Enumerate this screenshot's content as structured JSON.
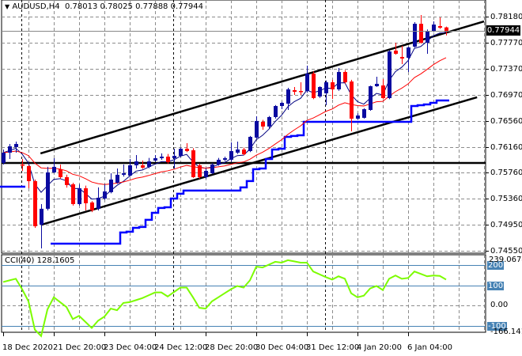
{
  "header": {
    "symbol": "AUDUSD,H4",
    "ohlc_text": "0.78013 0.78025 0.77888 0.77944"
  },
  "current_price": "0.77944",
  "cci_label": "CCI(40) 128.1605",
  "colors": {
    "bull": "#0a0aa0",
    "bear": "#ff0000",
    "ma_fast": "#000080",
    "ma_slow": "#ff0000",
    "step_line": "#0000ff",
    "cci": "#7cfc00",
    "level": "#4682b4",
    "grid": "#8c8c8c"
  },
  "chart_data": [
    {
      "type": "candlestick",
      "title": "AUDUSD,H4",
      "ylim": [
        0.7455,
        0.7818
      ],
      "price_ticks": [
        "0.78180",
        "0.77770",
        "0.77370",
        "0.76970",
        "0.76560",
        "0.76160",
        "0.75760",
        "0.75360",
        "0.74950",
        "0.74550"
      ],
      "time_labels": [
        {
          "text": "18 Dec 2020",
          "index": 0
        },
        {
          "text": "21 Dec 20:00",
          "index": 8
        },
        {
          "text": "23 Dec 04:00",
          "index": 16
        },
        {
          "text": "24 Dec 12:00",
          "index": 24
        },
        {
          "text": "28 Dec 20:00",
          "index": 32
        },
        {
          "text": "30 Dec 04:00",
          "index": 40
        },
        {
          "text": "31 Dec 12:00",
          "index": 48
        },
        {
          "text": "4 Jan 20:00",
          "index": 56
        },
        {
          "text": "6 Jan 04:00",
          "index": 64
        }
      ],
      "ohlc": [
        [
          0.75912,
          0.7612,
          0.75887,
          0.76071
        ],
        [
          0.76071,
          0.76206,
          0.75973,
          0.76169
        ],
        [
          0.76157,
          0.76243,
          0.76071,
          0.76206
        ],
        [
          0.75887,
          0.75973,
          0.75789,
          0.75875
        ],
        [
          0.75863,
          0.75875,
          0.75519,
          0.7563
        ],
        [
          0.7563,
          0.75654,
          0.74906,
          0.74931
        ],
        [
          0.74955,
          0.75274,
          0.74587,
          0.75201
        ],
        [
          0.75201,
          0.75851,
          0.75176,
          0.75765
        ],
        [
          0.75765,
          0.75985,
          0.75752,
          0.75851
        ],
        [
          0.75814,
          0.75887,
          0.75667,
          0.75691
        ],
        [
          0.75691,
          0.75728,
          0.7553,
          0.75569
        ],
        [
          0.75581,
          0.75605,
          0.7525,
          0.75274
        ],
        [
          0.75274,
          0.75581,
          0.7525,
          0.75519
        ],
        [
          0.75519,
          0.7556,
          0.75176,
          0.75287
        ],
        [
          0.75299,
          0.7532,
          0.7515,
          0.75176
        ],
        [
          0.75201,
          0.75532,
          0.75176,
          0.75372
        ],
        [
          0.7536,
          0.75581,
          0.7534,
          0.7547
        ],
        [
          0.75458,
          0.75752,
          0.7544,
          0.75654
        ],
        [
          0.75605,
          0.75826,
          0.7559,
          0.75728
        ],
        [
          0.75728,
          0.75887,
          0.757,
          0.75752
        ],
        [
          0.75716,
          0.75973,
          0.757,
          0.75875
        ],
        [
          0.75875,
          0.76034,
          0.75826,
          0.75936
        ],
        [
          0.75875,
          0.75949,
          0.7582,
          0.75838
        ],
        [
          0.75851,
          0.7599,
          0.7583,
          0.75936
        ],
        [
          0.75949,
          0.76034,
          0.7593,
          0.75985
        ],
        [
          0.75985,
          0.7606,
          0.7596,
          0.7601
        ],
        [
          0.7601,
          0.7605,
          0.759,
          0.75924
        ],
        [
          0.75985,
          0.76132,
          0.75826,
          0.76022
        ],
        [
          0.76022,
          0.7615,
          0.76,
          0.76132
        ],
        [
          0.76132,
          0.76218,
          0.7608,
          0.76096
        ],
        [
          0.76108,
          0.7614,
          0.7568,
          0.75691
        ],
        [
          0.75875,
          0.759,
          0.75667,
          0.75691
        ],
        [
          0.75691,
          0.7583,
          0.75667,
          0.75789
        ],
        [
          0.75752,
          0.7591,
          0.7574,
          0.75887
        ],
        [
          0.75887,
          0.7599,
          0.7587,
          0.75961
        ],
        [
          0.75961,
          0.7601,
          0.7594,
          0.75985
        ],
        [
          0.75961,
          0.7623,
          0.7593,
          0.76096
        ],
        [
          0.76071,
          0.76243,
          0.7605,
          0.7612
        ],
        [
          0.7612,
          0.7615,
          0.7603,
          0.76047
        ],
        [
          0.76096,
          0.7633,
          0.7608,
          0.76316
        ],
        [
          0.76304,
          0.76635,
          0.7629,
          0.76562
        ],
        [
          0.76549,
          0.7658,
          0.76427,
          0.76476
        ],
        [
          0.76476,
          0.7664,
          0.7645,
          0.76623
        ],
        [
          0.76623,
          0.7681,
          0.766,
          0.76794
        ],
        [
          0.76794,
          0.7686,
          0.76745,
          0.76843
        ],
        [
          0.76831,
          0.77076,
          0.76733,
          0.77052
        ],
        [
          0.7704,
          0.77089,
          0.76966,
          0.77015
        ],
        [
          0.77027,
          0.77162,
          0.76966,
          0.77015
        ],
        [
          0.77027,
          0.7742,
          0.77,
          0.77297
        ],
        [
          0.77297,
          0.7733,
          0.769,
          0.76917
        ],
        [
          0.76942,
          0.771,
          0.7692,
          0.77089
        ],
        [
          0.76991,
          0.7719,
          0.76807,
          0.77162
        ],
        [
          0.77162,
          0.772,
          0.76905,
          0.77052
        ],
        [
          0.77052,
          0.77383,
          0.7703,
          0.77322
        ],
        [
          0.77322,
          0.7735,
          0.7714,
          0.77162
        ],
        [
          0.77174,
          0.772,
          0.76402,
          0.76598
        ],
        [
          0.76598,
          0.7668,
          0.7658,
          0.76647
        ],
        [
          0.76611,
          0.7676,
          0.766,
          0.76745
        ],
        [
          0.76733,
          0.7711,
          0.7672,
          0.77101
        ],
        [
          0.77101,
          0.77248,
          0.7709,
          0.77138
        ],
        [
          0.77113,
          0.77211,
          0.769,
          0.76917
        ],
        [
          0.76917,
          0.7766,
          0.769,
          0.7764
        ],
        [
          0.77653,
          0.77775,
          0.7759,
          0.77604
        ],
        [
          0.77555,
          0.77726,
          0.77444,
          0.7753
        ],
        [
          0.77542,
          0.77714,
          0.77322,
          0.77702
        ],
        [
          0.77714,
          0.78094,
          0.777,
          0.78069
        ],
        [
          0.78069,
          0.78204,
          0.7776,
          0.77775
        ],
        [
          0.77775,
          0.7798,
          0.77604,
          0.77959
        ],
        [
          0.77959,
          0.78106,
          0.7794,
          0.78057
        ],
        [
          0.78033,
          0.78168,
          0.7799,
          0.78008
        ],
        [
          0.78013,
          0.78025,
          0.77888,
          0.77944
        ]
      ],
      "step_line": [
        0.75544,
        0.75544,
        0.75544,
        0.75544,
        null,
        null,
        null,
        null,
        0.74661,
        0.74661,
        0.74661,
        0.74661,
        0.74661,
        0.74661,
        0.74661,
        0.74661,
        0.74661,
        0.74661,
        0.74661,
        0.74833,
        0.74845,
        0.74906,
        0.74919,
        0.75029,
        0.75139,
        0.75213,
        0.75225,
        0.7536,
        0.75434,
        0.75483,
        0.75483,
        0.75483,
        0.75483,
        0.75483,
        0.75483,
        0.75483,
        0.75483,
        0.75483,
        0.75532,
        0.7563,
        0.75814,
        0.75826,
        0.75973,
        0.7612,
        0.76132,
        0.76316,
        0.76329,
        0.76341,
        0.76549,
        0.76549,
        0.76549,
        0.76549,
        0.76549,
        0.76549,
        0.76549,
        0.76549,
        0.76549,
        0.76549,
        0.76549,
        0.76549,
        0.76549,
        0.76549,
        0.76549,
        0.76549,
        0.76549,
        0.76794,
        0.76807,
        0.76819,
        0.76843,
        0.7688,
        0.7688
      ],
      "horizontal_line": 0.7591,
      "trendlines": [
        {
          "from": [
            5.9,
            0.76059
          ],
          "to": [
            76,
            0.78106
          ]
        },
        {
          "from": [
            6.1,
            0.74955
          ],
          "to": [
            74.9,
            0.7693
          ]
        }
      ]
    },
    {
      "type": "line",
      "title": "CCI(40) 128.1605",
      "axis_top_label": "239.0674",
      "axis_bottom_label": "-166.1414",
      "levels": [
        {
          "label": "200",
          "value": 200
        },
        {
          "label": "100",
          "value": 100
        },
        {
          "label": "-100",
          "value": -100
        }
      ],
      "zero_label": "0.00",
      "values": [
        116,
        124,
        132,
        80,
        20,
        -120,
        -152,
        -20,
        40,
        16,
        -8,
        -68,
        -52,
        -82,
        -112,
        -76,
        -56,
        -16,
        -24,
        12,
        16,
        26,
        36,
        50,
        64,
        64,
        44,
        66,
        88,
        88,
        40,
        -12,
        -16,
        20,
        40,
        60,
        80,
        96,
        88,
        124,
        192,
        188,
        202,
        216,
        212,
        224,
        218,
        212,
        212,
        168,
        154,
        140,
        128,
        144,
        132,
        60,
        40,
        48,
        84,
        96,
        76,
        132,
        148,
        132,
        136,
        168,
        156,
        144,
        148,
        146,
        128.16
      ]
    }
  ]
}
